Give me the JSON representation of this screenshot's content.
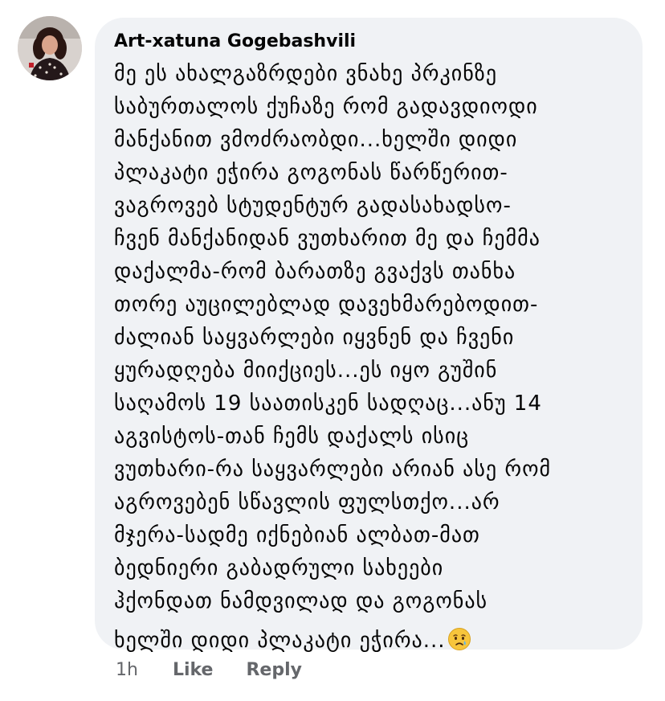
{
  "comment": {
    "author": "Art-xatuna Gogebashvili",
    "avatar_icon": "profile-photo",
    "body_lines": [
      "მე ეს ახალგაზრდები ვნახე პრკინზე",
      "საბურთალოს ქუჩაზე რომ გადავდიოდი",
      "მანქანით ვმოძრაობდი...ხელში დიდი",
      "პლაკატი ეჭირა გოგონას წარწერით-",
      "ვაგროვებ სტუდენტურ გადასახადსო-",
      "ჩვენ მანქანიდან ვუთხარით მე და ჩემმა",
      "დაქალმა-რომ ბარათზე გვაქვს თანხა",
      "თორე აუცილებლად დავეხმარებოდით-",
      "ძალიან საყვარლები იყვნენ და ჩვენი",
      "ყურადღება მიიქციეს...ეს იყო გუშინ",
      "საღამოს 19 საათისკენ სადღაც...ანუ 14",
      "აგვისტოს-თან ჩემს დაქალს ისიც",
      "ვუთხარი-რა საყვარლები არიან ასე რომ",
      "აგროვებენ სწავლის ფულსთქო...არ",
      "მჯერა-სადმე იქნებიან ალბათ-მათ",
      "ბედნიერი გაბადრული სახეები",
      "ჰქონდათ ნამდვილად და გოგონას",
      "ხელში დიდი პლაკატი ეჭირა..."
    ],
    "emoji_icon": "crying-face-emoji",
    "time": "1h",
    "like_label": "Like",
    "reply_label": "Reply"
  },
  "colors": {
    "bubble_background": "#f0f2f5",
    "text": "#050505",
    "secondary_text": "#65676b"
  }
}
